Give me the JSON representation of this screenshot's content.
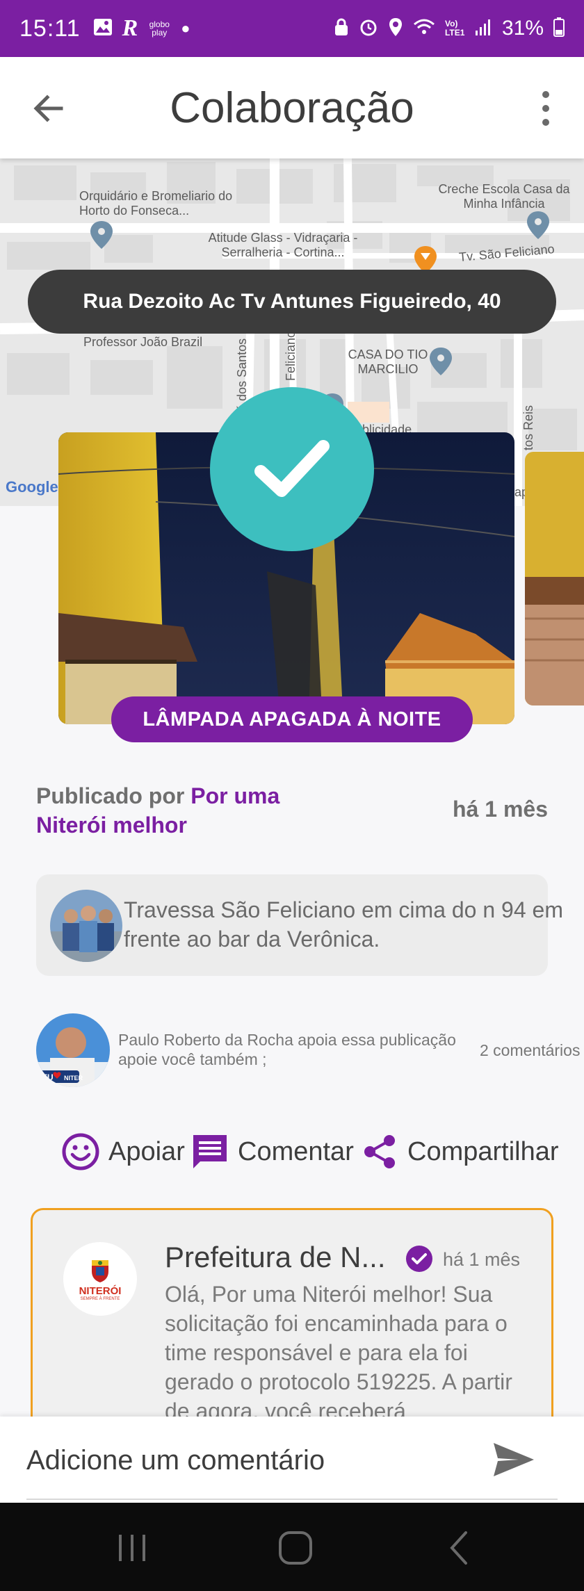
{
  "status_bar": {
    "time": "15:11",
    "left_icons": [
      "image-icon",
      "r-app-icon",
      "globoplay-icon",
      "dot-icon"
    ],
    "globoplay_label": "globo play",
    "signal_label": "Vo) LTE1",
    "battery": "31%"
  },
  "app_bar": {
    "title": "Colaboração"
  },
  "map": {
    "labels": {
      "orquidario": "Orquidário e Bromeliario do Horto do Fonseca...",
      "creche": "Creche Escola Casa da Minha Infância",
      "atitude": "Atitude Glass - Vidraçaria - Serralheria - Cortina...",
      "tv_sao_feliciano": "Tv. São Feliciano",
      "professor": "Professor João Brazil",
      "casa_do_tio": "CASA DO TIO MARCILIO",
      "jose_dos_santos": "José dos Santos",
      "feliciano": "Feliciano",
      "sauer": "Sauer Publicidade",
      "tos_reis": "tos Reis",
      "google": "Google",
      "ap": "ap"
    },
    "address": "Rua Dezoito Ac Tv Antunes Figueiredo, 40"
  },
  "post": {
    "category": "LÂMPADA APAGADA À NOITE",
    "published_by_label": "Publicado por",
    "author": "Por uma Niterói melhor",
    "time": "há 1 mês",
    "description": "Travessa São Feliciano em cima do n 94 em frente ao bar da Verônica."
  },
  "supporters": {
    "text": "Paulo Roberto da Rocha  apoia essa publicação apoie você também ;",
    "comments": "2 comentários"
  },
  "actions": {
    "support": "Apoiar",
    "comment": "Comentar",
    "share": "Compartilhar"
  },
  "reply": {
    "org": "Prefeitura de N...",
    "logo_text": "NITERÓI",
    "logo_subtext": "SEMPRE À FRENTE",
    "time": "há 1 mês",
    "text": "Olá, Por uma Niterói melhor! Sua solicitação foi encaminhada para o time responsável e para ela foi gerado o protocolo 519225. A partir de agora, você receberá"
  },
  "comment_bar": {
    "placeholder": "Adicione um comentário"
  },
  "colors": {
    "primary": "#7b1fa2",
    "teal": "#3dbfbf",
    "reply_border": "#f0a020",
    "pill_dark": "#3c3c3c"
  }
}
